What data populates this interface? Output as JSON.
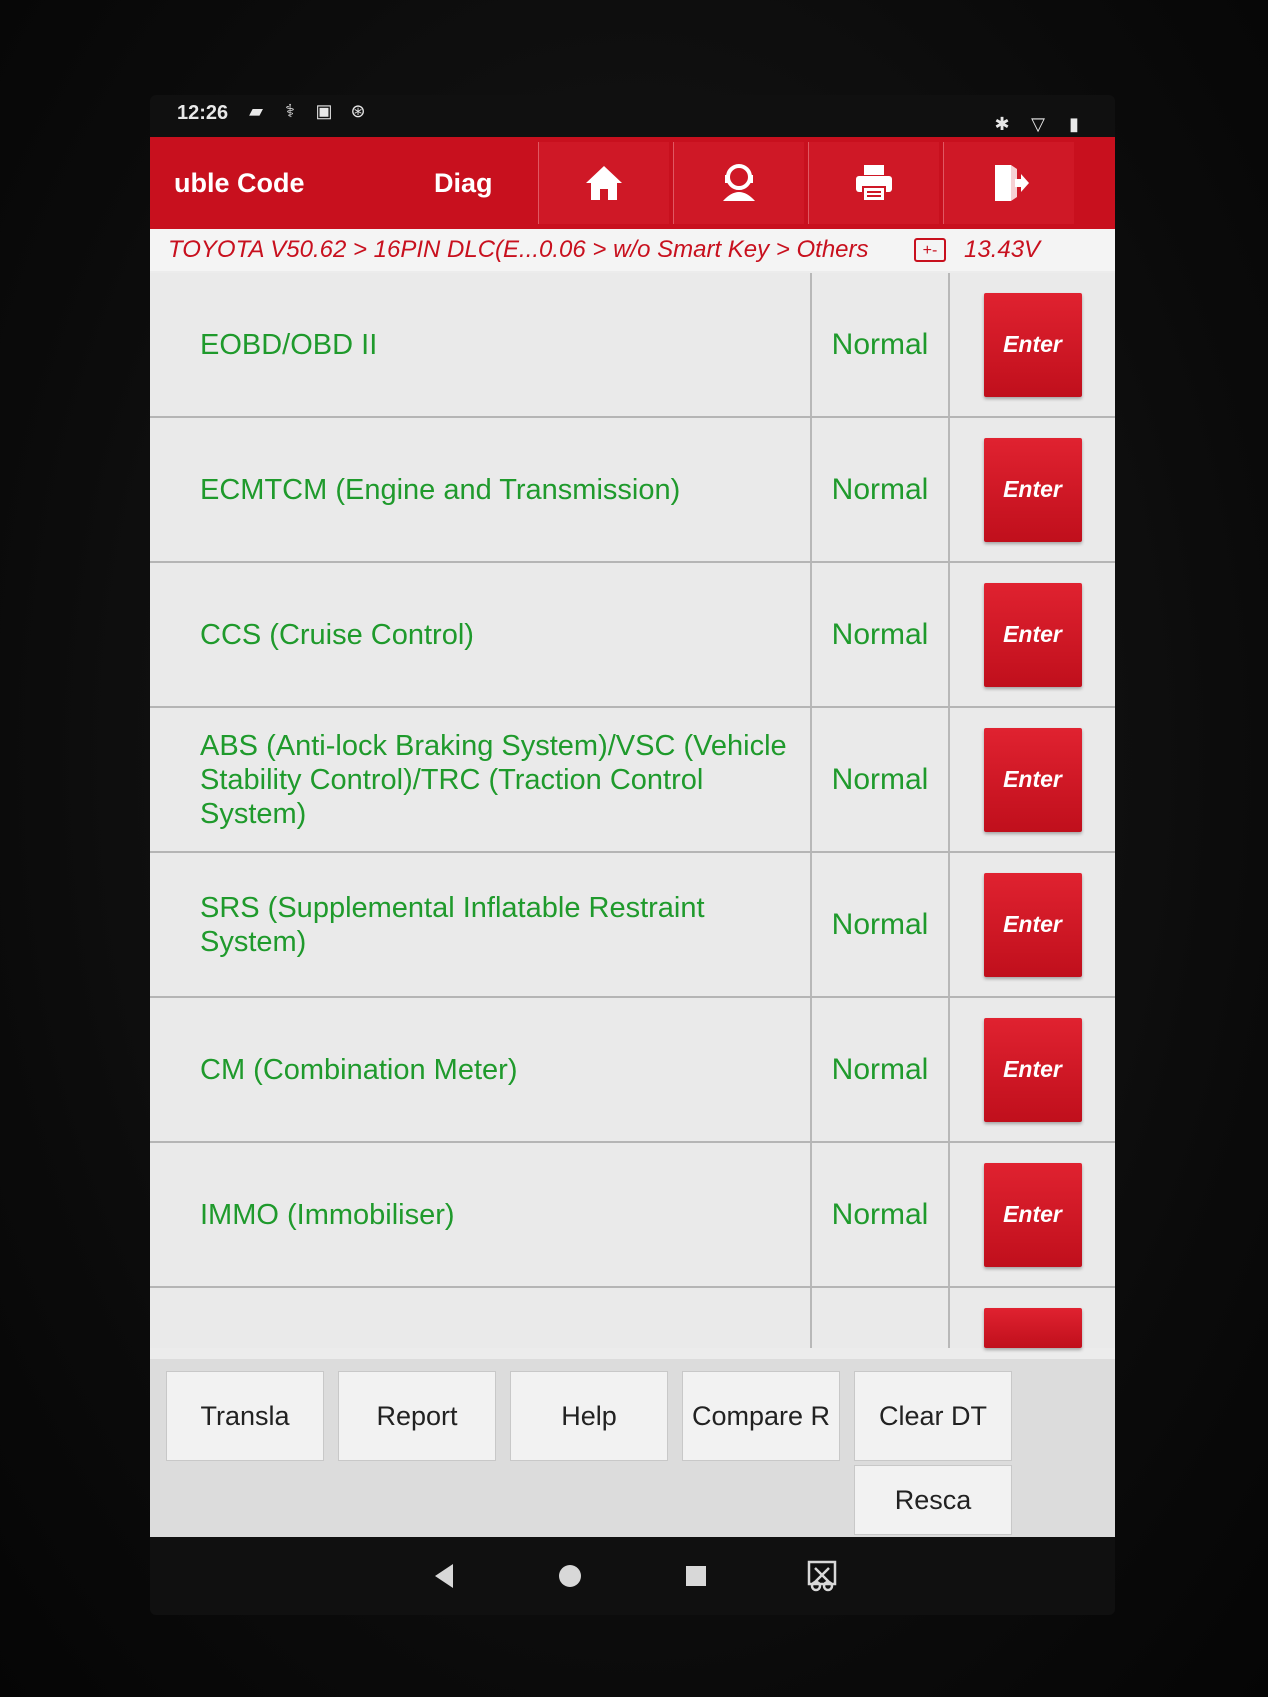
{
  "status_bar": {
    "time": "12:26"
  },
  "header": {
    "tab_trouble": "uble Code",
    "tab_diag": "Diag",
    "buttons": [
      {
        "icon": "home-icon"
      },
      {
        "icon": "support-icon"
      },
      {
        "icon": "print-icon"
      },
      {
        "icon": "exit-icon"
      }
    ]
  },
  "breadcrumb": {
    "path": "TOYOTA V50.62 > 16PIN DLC(E...0.06 > w/o Smart Key > Others",
    "battery_icon": "+-",
    "voltage": "13.43V"
  },
  "systems": [
    {
      "name": "EOBD/OBD II",
      "status": "Normal",
      "action": "Enter"
    },
    {
      "name": "ECMTCM (Engine and Transmission)",
      "status": "Normal",
      "action": "Enter"
    },
    {
      "name": "CCS (Cruise Control)",
      "status": "Normal",
      "action": "Enter"
    },
    {
      "name": "ABS (Anti-lock Braking System)/VSC (Vehicle Stability Control)/TRC (Traction Control System)",
      "status": "Normal",
      "action": "Enter"
    },
    {
      "name": "SRS (Supplemental Inflatable Restraint System)",
      "status": "Normal",
      "action": "Enter"
    },
    {
      "name": "CM (Combination Meter)",
      "status": "Normal",
      "action": "Enter"
    },
    {
      "name": "IMMO (Immobiliser)",
      "status": "Normal",
      "action": "Enter"
    }
  ],
  "footer": {
    "translate": "Transla",
    "report": "Report",
    "help": "Help",
    "compare": "Compare R",
    "clear_dtc": "Clear DT",
    "rescan": "Resca"
  },
  "colors": {
    "brand_red": "#c8101e",
    "status_green": "#1f9a2c"
  }
}
